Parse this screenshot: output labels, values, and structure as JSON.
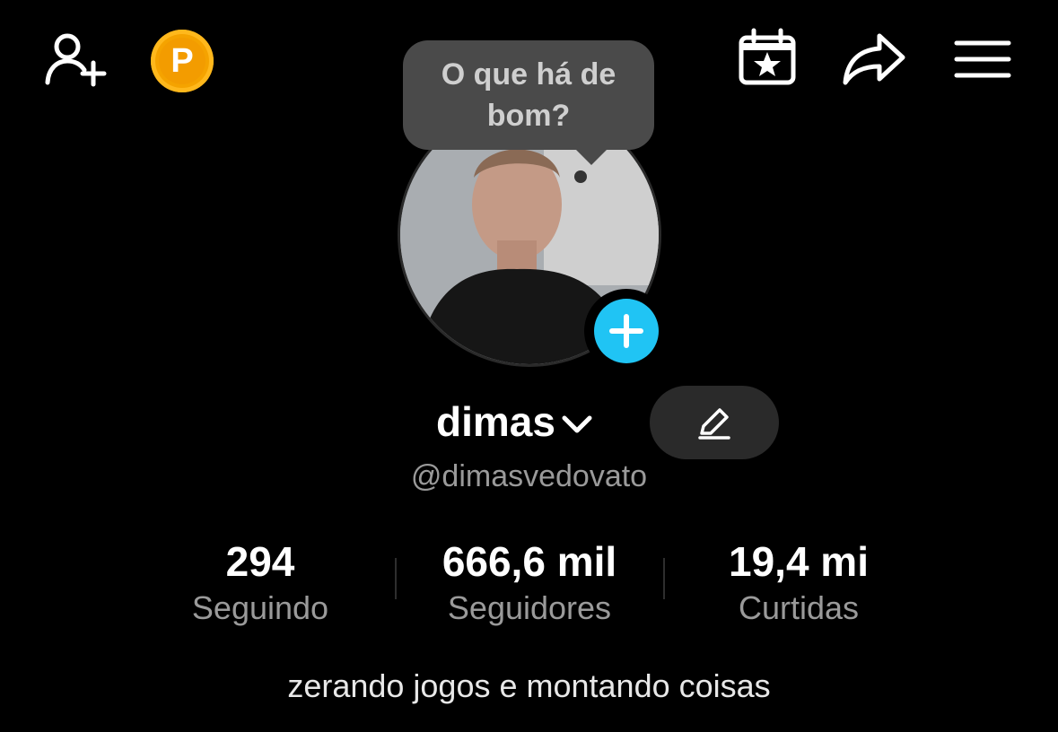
{
  "header": {
    "icons": {
      "add_friend": "add-friend-icon",
      "coin": "coin-icon",
      "calendar": "calendar-star-icon",
      "share": "share-icon",
      "menu": "menu-icon"
    },
    "coin_letter": "P"
  },
  "bubble": {
    "text": "O que há de bom?"
  },
  "profile": {
    "display_name": "dimas",
    "handle": "@dimasvedovato",
    "bio": "zerando jogos e montando coisas"
  },
  "stats": [
    {
      "value": "294",
      "label": "Seguindo"
    },
    {
      "value": "666,6 mil",
      "label": "Seguidores"
    },
    {
      "value": "19,4 mi",
      "label": "Curtidas"
    }
  ],
  "colors": {
    "background": "#000000",
    "accent": "#20C4F4",
    "coin": "#F5A300",
    "bubble": "#4A4A4A",
    "edit_button": "#2A2A2A"
  }
}
